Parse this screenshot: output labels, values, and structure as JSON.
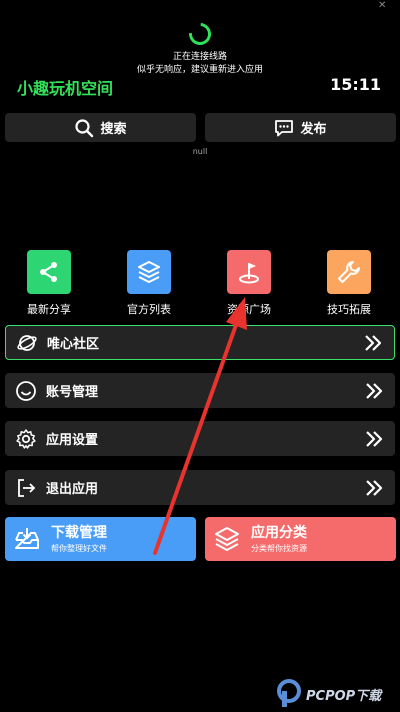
{
  "status": {
    "line1": "正在连接线路",
    "line2": "似乎无响应，建议重新进入应用"
  },
  "header": {
    "app_title": "小趣玩机空间",
    "clock": "15:11"
  },
  "toolbar": {
    "search_label": "搜索",
    "post_label": "发布"
  },
  "null_text": "null",
  "grid": [
    {
      "label": "最新分享",
      "icon": "share-icon",
      "color": "#2ed573"
    },
    {
      "label": "官方列表",
      "icon": "layers-icon",
      "color": "#4a9df6"
    },
    {
      "label": "资源广场",
      "icon": "flag-icon",
      "color": "#f56b6b"
    },
    {
      "label": "技巧拓展",
      "icon": "wrench-icon",
      "color": "#fba55e"
    }
  ],
  "rows": [
    {
      "label": "唯心社区",
      "icon": "planet-icon"
    },
    {
      "label": "账号管理",
      "icon": "smile-icon"
    },
    {
      "label": "应用设置",
      "icon": "gear-icon"
    },
    {
      "label": "退出应用",
      "icon": "logout-icon"
    }
  ],
  "cards": {
    "download": {
      "title": "下载管理",
      "subtitle": "帮你整理好文件",
      "color": "#4a9df6"
    },
    "category": {
      "title": "应用分类",
      "subtitle": "分类帮你找资源",
      "color": "#f56b6b"
    }
  },
  "watermark": {
    "text": "PCPOP下载"
  }
}
